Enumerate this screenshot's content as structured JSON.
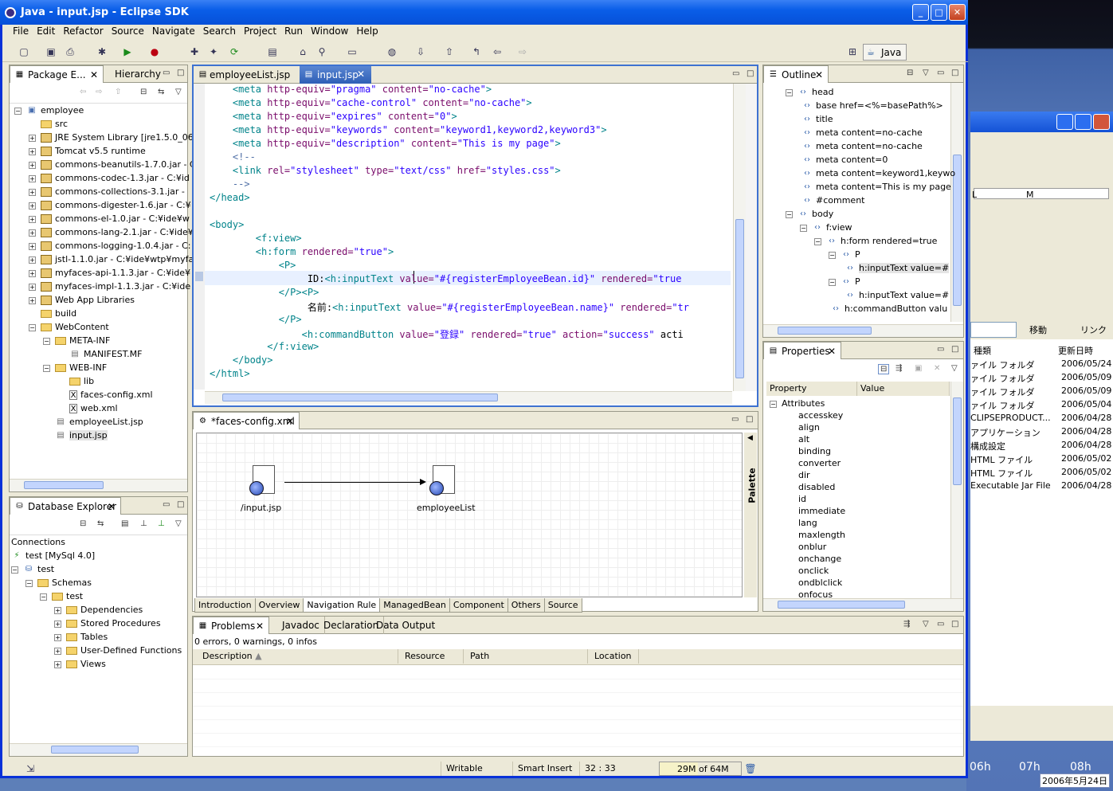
{
  "window": {
    "title": "Java - input.jsp - Eclipse SDK"
  },
  "menu": [
    "File",
    "Edit",
    "Refactor",
    "Source",
    "Navigate",
    "Search",
    "Project",
    "Run",
    "Window",
    "Help"
  ],
  "perspective": "Java",
  "package_explorer": {
    "tabs": [
      "Package E...",
      "Hierarchy"
    ],
    "items": [
      {
        "label": "employee",
        "level": 0,
        "exp": "-",
        "icon": "project"
      },
      {
        "label": "src",
        "level": 1,
        "exp": "",
        "icon": "src"
      },
      {
        "label": "JRE System Library [jre1.5.0_06",
        "level": 1,
        "exp": "+",
        "icon": "jar"
      },
      {
        "label": "Tomcat v5.5 runtime",
        "level": 1,
        "exp": "+",
        "icon": "jar"
      },
      {
        "label": "commons-beanutils-1.7.0.jar - C",
        "level": 1,
        "exp": "+",
        "icon": "jar"
      },
      {
        "label": "commons-codec-1.3.jar - C:¥id",
        "level": 1,
        "exp": "+",
        "icon": "jar"
      },
      {
        "label": "commons-collections-3.1.jar -",
        "level": 1,
        "exp": "+",
        "icon": "jar"
      },
      {
        "label": "commons-digester-1.6.jar - C:¥",
        "level": 1,
        "exp": "+",
        "icon": "jar"
      },
      {
        "label": "commons-el-1.0.jar - C:¥ide¥w",
        "level": 1,
        "exp": "+",
        "icon": "jar"
      },
      {
        "label": "commons-lang-2.1.jar - C:¥ide¥",
        "level": 1,
        "exp": "+",
        "icon": "jar"
      },
      {
        "label": "commons-logging-1.0.4.jar - C:",
        "level": 1,
        "exp": "+",
        "icon": "jar"
      },
      {
        "label": "jstl-1.1.0.jar - C:¥ide¥wtp¥myfa",
        "level": 1,
        "exp": "+",
        "icon": "jar"
      },
      {
        "label": "myfaces-api-1.1.3.jar - C:¥ide¥",
        "level": 1,
        "exp": "+",
        "icon": "jar"
      },
      {
        "label": "myfaces-impl-1.1.3.jar - C:¥ide",
        "level": 1,
        "exp": "+",
        "icon": "jar"
      },
      {
        "label": "Web App Libraries",
        "level": 1,
        "exp": "+",
        "icon": "jar"
      },
      {
        "label": "build",
        "level": 1,
        "exp": "",
        "icon": "folder"
      },
      {
        "label": "WebContent",
        "level": 1,
        "exp": "-",
        "icon": "folder"
      },
      {
        "label": "META-INF",
        "level": 2,
        "exp": "-",
        "icon": "folder"
      },
      {
        "label": "MANIFEST.MF",
        "level": 3,
        "exp": "",
        "icon": "file"
      },
      {
        "label": "WEB-INF",
        "level": 2,
        "exp": "-",
        "icon": "folder"
      },
      {
        "label": "lib",
        "level": 3,
        "exp": "",
        "icon": "folder"
      },
      {
        "label": "faces-config.xml",
        "level": 3,
        "exp": "",
        "icon": "xml"
      },
      {
        "label": "web.xml",
        "level": 3,
        "exp": "",
        "icon": "xml"
      },
      {
        "label": "employeeList.jsp",
        "level": 2,
        "exp": "",
        "icon": "file"
      },
      {
        "label": "input.jsp",
        "level": 2,
        "exp": "",
        "icon": "file"
      }
    ]
  },
  "db_explorer": {
    "title": "Database Explorer",
    "items": [
      {
        "label": "Connections",
        "level": 0,
        "exp": ""
      },
      {
        "label": "test [MySql 4.0]",
        "level": 0,
        "exp": ""
      },
      {
        "label": "test",
        "level": 0,
        "exp": "-"
      },
      {
        "label": "Schemas",
        "level": 1,
        "exp": "-"
      },
      {
        "label": "test",
        "level": 2,
        "exp": "-"
      },
      {
        "label": "Dependencies",
        "level": 3,
        "exp": "+"
      },
      {
        "label": "Stored Procedures",
        "level": 3,
        "exp": "+"
      },
      {
        "label": "Tables",
        "level": 3,
        "exp": "+"
      },
      {
        "label": "User-Defined Functions",
        "level": 3,
        "exp": "+"
      },
      {
        "label": "Views",
        "level": 3,
        "exp": "+"
      }
    ]
  },
  "editor": {
    "tabs": [
      "employeeList.jsp",
      "input.jsp"
    ],
    "lines": [
      "    <meta http-equiv=\"pragma\" content=\"no-cache\">",
      "    <meta http-equiv=\"cache-control\" content=\"no-cache\">",
      "    <meta http-equiv=\"expires\" content=\"0\">",
      "    <meta http-equiv=\"keywords\" content=\"keyword1,keyword2,keyword3\">",
      "    <meta http-equiv=\"description\" content=\"This is my page\">",
      "    <!--",
      "    <link rel=\"stylesheet\" type=\"text/css\" href=\"styles.css\">",
      "    -->",
      "</head>",
      "",
      "<body>",
      "        <f:view>",
      "        <h:form rendered=\"true\">",
      "            <P>",
      "                 ID:<h:inputText value=\"#{registerEmployeeBean.id}\" rendered=\"true",
      "            </P><P>",
      "                 名前:<h:inputText value=\"#{registerEmployeeBean.name}\" rendered=\"tr",
      "            </P>",
      "                <h:commandButton value=\"登録\" rendered=\"true\" action=\"success\" acti",
      "          </f:view>",
      "    </body>",
      "</html>"
    ]
  },
  "faces_editor": {
    "tab": "*faces-config.xml",
    "nodes": [
      "/input.jsp",
      "employeeList"
    ],
    "palette": "Palette",
    "subtabs": [
      "Introduction",
      "Overview",
      "Navigation Rule",
      "ManagedBean",
      "Component",
      "Others",
      "Source"
    ]
  },
  "outline": {
    "title": "Outline",
    "items": [
      {
        "label": "head",
        "level": 0
      },
      {
        "label": "base href=<%=basePath%>",
        "level": 1
      },
      {
        "label": "title",
        "level": 1
      },
      {
        "label": "meta content=no-cache",
        "level": 1
      },
      {
        "label": "meta content=no-cache",
        "level": 1
      },
      {
        "label": "meta content=0",
        "level": 1
      },
      {
        "label": "meta content=keyword1,keywo",
        "level": 1
      },
      {
        "label": "meta content=This is my page",
        "level": 1
      },
      {
        "label": "#comment",
        "level": 1
      },
      {
        "label": "body",
        "level": 0
      },
      {
        "label": "f:view",
        "level": 1
      },
      {
        "label": "h:form rendered=true",
        "level": 2
      },
      {
        "label": "P",
        "level": 3
      },
      {
        "label": "h:inputText value=#",
        "level": 4
      },
      {
        "label": "P",
        "level": 3
      },
      {
        "label": "h:inputText value=#",
        "level": 4
      },
      {
        "label": "h:commandButton valu",
        "level": 3
      }
    ]
  },
  "properties": {
    "title": "Properties",
    "cols": [
      "Property",
      "Value"
    ],
    "group": "Attributes",
    "rows": [
      "accesskey",
      "align",
      "alt",
      "binding",
      "converter",
      "dir",
      "disabled",
      "id",
      "immediate",
      "lang",
      "maxlength",
      "onblur",
      "onchange",
      "onclick",
      "ondblclick",
      "onfocus"
    ]
  },
  "problems": {
    "tabs": [
      "Problems",
      "Javadoc",
      "Declaration",
      "Data Output"
    ],
    "summary": "0 errors, 0 warnings, 0 infos",
    "cols": [
      "Description",
      "Resource",
      "Path",
      "Location"
    ]
  },
  "status": {
    "writable": "Writable",
    "insert": "Smart Insert",
    "pos": "32 : 33",
    "heap": "29M of 64M"
  },
  "desktop": {
    "rows": [
      [
        "ァイル フォルダ",
        "2006/05/24"
      ],
      [
        "ァイル フォルダ",
        "2006/05/09"
      ],
      [
        "ァイル フォルダ",
        "2006/05/09"
      ],
      [
        "ァイル フォルダ",
        "2006/05/04"
      ],
      [
        "CLIPSEPRODUCT...",
        "2006/04/28"
      ],
      [
        "アプリケーション",
        "2006/04/28"
      ],
      [
        "構成設定",
        "2006/04/28"
      ],
      [
        "HTML ファイル",
        "2006/05/02"
      ],
      [
        "HTML ファイル",
        "2006/05/02"
      ],
      [
        "Executable Jar File",
        "2006/04/28"
      ]
    ],
    "col1": "種類",
    "col2": "更新日時",
    "goto": "移動",
    "link": "リンク",
    "M": "M",
    "L": "L",
    "hours": [
      "06h",
      "07h",
      "08h"
    ],
    "clock": "2006年5月24日"
  }
}
